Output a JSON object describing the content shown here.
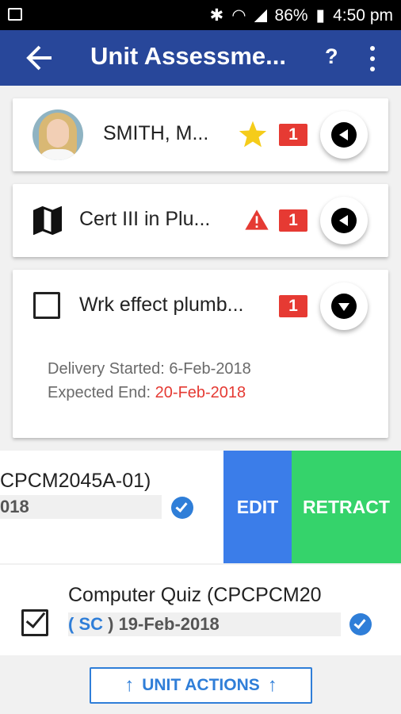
{
  "status_bar": {
    "battery": "86%",
    "time": "4:50 pm"
  },
  "app_bar": {
    "title": "Unit Assessme...",
    "help_label": "?"
  },
  "cards": {
    "student": {
      "name": "SMITH, M...",
      "badge": "1"
    },
    "qualification": {
      "name": "Cert III in Plu...",
      "badge": "1"
    },
    "unit": {
      "name": "Wrk effect plumb...",
      "badge": "1",
      "delivery_started_label": "Delivery Started:",
      "delivery_started_value": "6-Feb-2018",
      "expected_end_label": "Expected End:",
      "expected_end_value": "20-Feb-2018"
    }
  },
  "swiped_row": {
    "title": "CPCM2045A-01)",
    "date": "018",
    "edit_label": "EDIT",
    "retract_label": "RETRACT"
  },
  "assessment_row": {
    "title": "Computer Quiz (CPCPCM20",
    "open_paren": "( ",
    "code": "SC",
    "close_paren_date": " ) 19-Feb-2018"
  },
  "bottom": {
    "unit_actions_label": "UNIT ACTIONS"
  },
  "colors": {
    "app_bar": "#28479a",
    "badge": "#e63a33",
    "edit": "#3b7de9",
    "retract": "#35d36b",
    "accent": "#2f7ed8",
    "star": "#f5cc1a"
  }
}
